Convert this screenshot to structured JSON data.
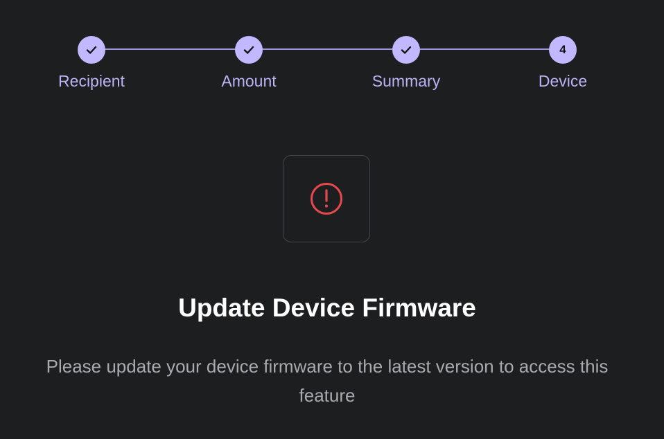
{
  "stepper": {
    "steps": [
      {
        "label": "Recipient",
        "state": "completed",
        "marker": ""
      },
      {
        "label": "Amount",
        "state": "completed",
        "marker": ""
      },
      {
        "label": "Summary",
        "state": "completed",
        "marker": ""
      },
      {
        "label": "Device",
        "state": "current",
        "marker": "4"
      }
    ]
  },
  "colors": {
    "background": "#1d1e20",
    "accent": "#c1b8ff",
    "error": "#e5484d"
  },
  "status_icon": "error-circle-icon",
  "content": {
    "title": "Update Device Firmware",
    "description": "Please update your device firmware to the latest version to access this feature"
  }
}
